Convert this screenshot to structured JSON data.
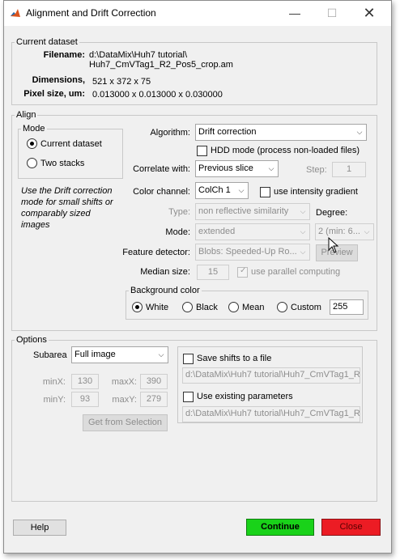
{
  "window": {
    "title": "Alignment and Drift Correction"
  },
  "current_dataset": {
    "heading": "Current dataset",
    "filename_label": "Filename:",
    "filename_line1": "d:\\DataMix\\Huh7 tutorial\\",
    "filename_line2": "Huh7_CmVTag1_R2_Pos5_crop.am",
    "dimensions_label": "Dimensions,",
    "dimensions_value": "521 x 372 x 75",
    "pixel_size_label": "Pixel size, um:",
    "pixel_size_value": "0.013000 x 0.013000 x 0.030000"
  },
  "align": {
    "heading": "Align",
    "mode": {
      "heading": "Mode",
      "current_dataset": "Current dataset",
      "two_stacks": "Two stacks",
      "selected": "Current dataset"
    },
    "hint": [
      "Use the Drift correction",
      "mode for small shifts or",
      "comparably sized",
      "images"
    ],
    "algorithm_label": "Algorithm:",
    "algorithm_value": "Drift correction",
    "hdd_mode_label": "HDD mode (process non-loaded files)",
    "correlate_label": "Correlate with:",
    "correlate_value": "Previous slice",
    "step_label": "Step:",
    "step_value": "1",
    "color_channel_label": "Color channel:",
    "color_channel_value": "ColCh 1",
    "intensity_gradient_label": "use intensity gradient",
    "type_label": "Type:",
    "type_value": "non reflective similarity",
    "degree_label": "Degree:",
    "mode_label": "Mode:",
    "mode_value": "extended",
    "degree_value": "2 (min: 6...",
    "feature_detector_label": "Feature detector:",
    "feature_detector_value": "Blobs: Speeded-Up Ro...",
    "preview_label": "Preview",
    "median_size_label": "Median size:",
    "median_size_value": "15",
    "parallel_label": "use parallel computing",
    "background": {
      "heading": "Background color",
      "white": "White",
      "black": "Black",
      "mean": "Mean",
      "custom": "Custom",
      "custom_value": "255",
      "selected": "White"
    }
  },
  "options": {
    "heading": "Options",
    "subarea_label": "Subarea",
    "subarea_value": "Full image",
    "minx_label": "minX:",
    "minx_value": "130",
    "maxx_label": "maxX:",
    "maxx_value": "390",
    "miny_label": "minY:",
    "miny_value": "93",
    "maxy_label": "maxY:",
    "maxy_value": "279",
    "get_from_selection": "Get from Selection",
    "save_shifts_label": "Save shifts to a file",
    "save_shifts_path": "d:\\DataMix\\Huh7 tutorial\\Huh7_CmVTag1_R2_",
    "use_existing_label": "Use existing parameters",
    "use_existing_path": "d:\\DataMix\\Huh7 tutorial\\Huh7_CmVTag1_R2_"
  },
  "footer": {
    "help": "Help",
    "continue": "Continue",
    "close": "Close"
  },
  "colors": {
    "continue_bg": "#19d219",
    "close_bg": "#ec1c24",
    "window_bg": "#f0f0f0"
  }
}
